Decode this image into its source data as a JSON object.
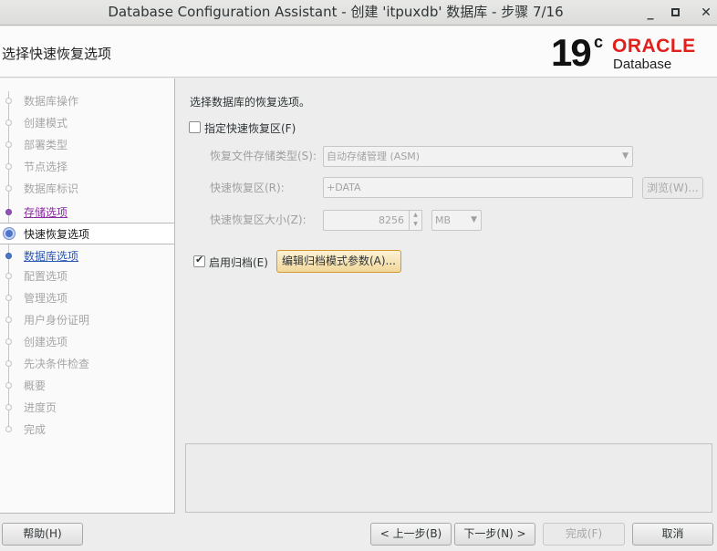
{
  "window": {
    "title": "Database Configuration Assistant - 创建 'itpuxdb' 数据库 - 步骤 7/16",
    "minimize": "_",
    "maximize": "□",
    "close": "✕"
  },
  "header": {
    "page_title": "选择快速恢复选项",
    "logo_version": "19",
    "logo_version_sup": "c",
    "logo_brand": "ORACLE",
    "logo_product": "Database"
  },
  "sidebar": {
    "items": [
      {
        "label": "数据库操作",
        "state": "disabled"
      },
      {
        "label": "创建模式",
        "state": "disabled"
      },
      {
        "label": "部署类型",
        "state": "disabled"
      },
      {
        "label": "节点选择",
        "state": "disabled"
      },
      {
        "label": "数据库标识",
        "state": "disabled"
      },
      {
        "label": "存储选项",
        "state": "visited"
      },
      {
        "label": "快速恢复选项",
        "state": "current"
      },
      {
        "label": "数据库选项",
        "state": "link"
      },
      {
        "label": "配置选项",
        "state": "disabled"
      },
      {
        "label": "管理选项",
        "state": "disabled"
      },
      {
        "label": "用户身份证明",
        "state": "disabled"
      },
      {
        "label": "创建选项",
        "state": "disabled"
      },
      {
        "label": "先决条件检查",
        "state": "disabled"
      },
      {
        "label": "概要",
        "state": "disabled"
      },
      {
        "label": "进度页",
        "state": "disabled"
      },
      {
        "label": "完成",
        "state": "disabled"
      }
    ]
  },
  "main": {
    "intro": "选择数据库的恢复选项。",
    "fra_checkbox": {
      "label": "指定快速恢复区(F)",
      "checked": false
    },
    "storage_type": {
      "label": "恢复文件存储类型(S):",
      "value": "自动存储管理 (ASM)"
    },
    "fra_location": {
      "label": "快速恢复区(R):",
      "value": "+DATA",
      "browse": "浏览(W)..."
    },
    "fra_size": {
      "label": "快速恢复区大小(Z):",
      "value": "8256",
      "unit": "MB"
    },
    "archive_checkbox": {
      "label": "启用归档(E)",
      "checked": true
    },
    "edit_archive_button": "编辑归档模式参数(A)..."
  },
  "footer": {
    "help": "帮助(H)",
    "back": "< 上一步(B)",
    "next": "下一步(N) >",
    "finish": "完成(F)",
    "cancel": "取消"
  },
  "colors": {
    "oracle_red": "#e0201c",
    "link_blue": "#2c57b4",
    "visited_purple": "#8a2aa0",
    "focus_button": "#f1d79a"
  }
}
